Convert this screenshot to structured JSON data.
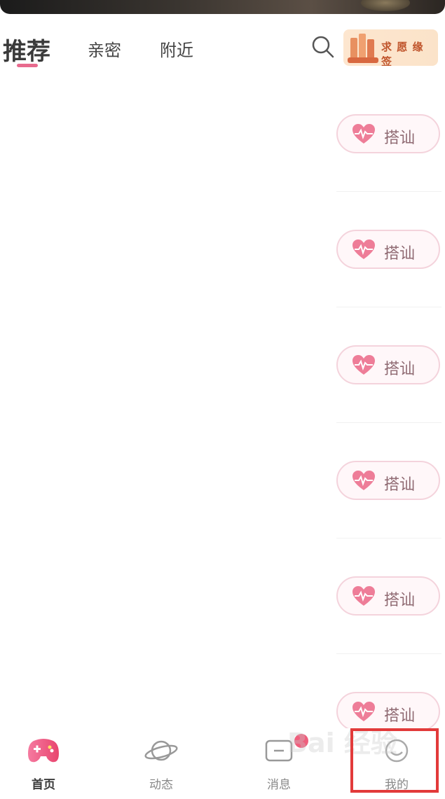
{
  "header": {
    "tabs": [
      "推荐",
      "亲密",
      "附近"
    ],
    "search_icon": "search-icon",
    "wish_label": "求 愿 缘 签"
  },
  "feed": {
    "greet_label": "搭讪",
    "rows": [
      {
        "button": "搭讪"
      },
      {
        "button": "搭讪"
      },
      {
        "button": "搭讪"
      },
      {
        "button": "搭讪"
      },
      {
        "button": "搭讪"
      },
      {
        "button": "搭讪"
      }
    ]
  },
  "bottom_nav": {
    "items": [
      {
        "label": "首页",
        "icon": "gamepad-icon"
      },
      {
        "label": "动态",
        "icon": "planet-icon"
      },
      {
        "label": "消息",
        "icon": "message-icon"
      },
      {
        "label": "我的",
        "icon": "profile-icon"
      }
    ]
  },
  "watermark": "Bai 经验",
  "colors": {
    "accent": "#e86a8e",
    "greet_text": "#8f6a72",
    "highlight": "#e23a3a"
  }
}
